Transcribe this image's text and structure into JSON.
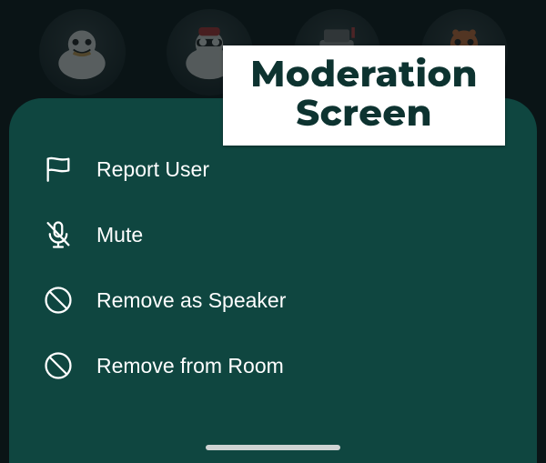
{
  "title": "Moderation\nScreen",
  "menu": {
    "items": [
      {
        "label": "Report User",
        "icon": "flag-icon"
      },
      {
        "label": "Mute",
        "icon": "mute-microphone-icon"
      },
      {
        "label": "Remove as Speaker",
        "icon": "block-icon"
      },
      {
        "label": "Remove from Room",
        "icon": "block-icon"
      }
    ]
  }
}
